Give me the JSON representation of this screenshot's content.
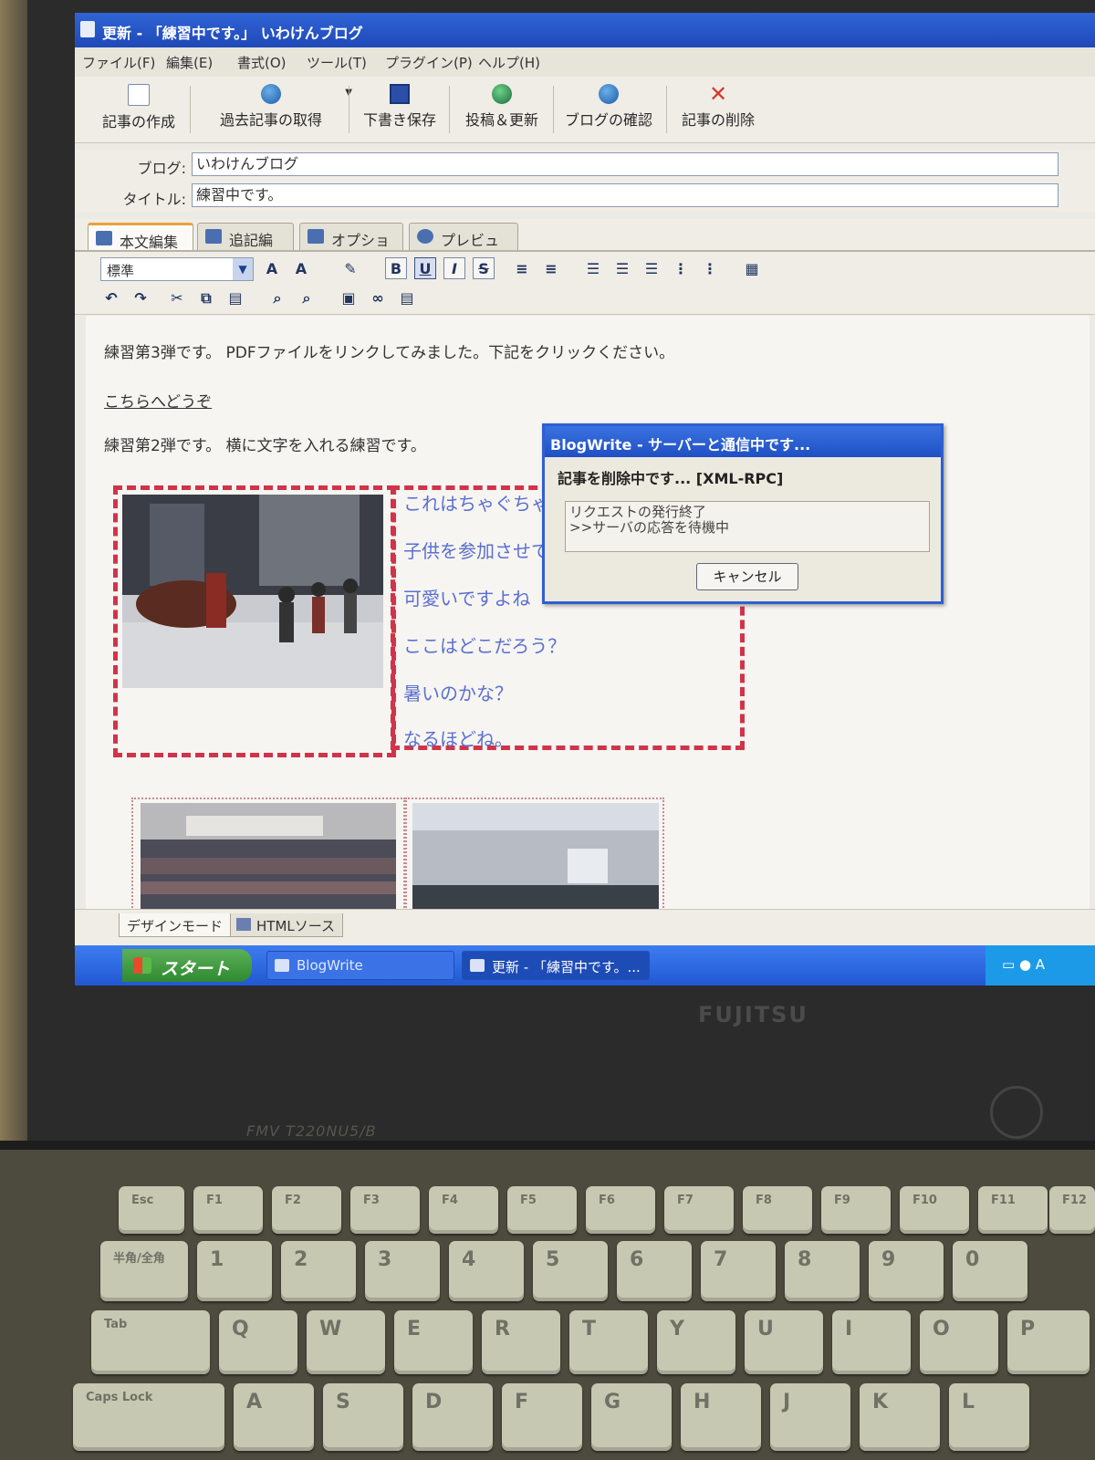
{
  "window": {
    "title": "更新 - 「練習中です。」 いわけんブログ"
  },
  "menubar": {
    "items": [
      "ファイル(F)",
      "編集(E)",
      "書式(O)",
      "ツール(T)",
      "プラグイン(P)",
      "ヘルプ(H)"
    ]
  },
  "toolbar": {
    "create": "記事の作成",
    "fetch": "過去記事の取得",
    "draft": "下書き保存",
    "post": "投稿＆更新",
    "check": "ブログの確認",
    "delete": "記事の削除"
  },
  "fields": {
    "blog_label": "ブログ:",
    "blog_value": "いわけんブログ",
    "title_label": "タイトル:",
    "title_value": "練習中です。"
  },
  "tabs": [
    "本文編集",
    "追記編集",
    "オプション",
    "プレビュー"
  ],
  "format": {
    "style_select": "標準",
    "bold": "B",
    "underline": "U",
    "italic": "I",
    "strike": "S"
  },
  "editor": {
    "line1": "練習第3弾です。 PDFファイルをリンクしてみました。下記をクリックください。",
    "link": "こちらへどうぞ",
    "line2": "練習第2弾です。 横に文字を入れる練習です。",
    "side_text": [
      "これはちゃぐちゃ",
      "子供を参加させて",
      "可愛いですよね",
      "ここはどこだろう？",
      "暑いのかな？",
      "なるほどね。"
    ]
  },
  "view_tabs": {
    "design": "デザインモード",
    "html": "HTMLソース"
  },
  "taskbar": {
    "start": "スタート",
    "task1": "BlogWrite",
    "task2": "更新 - 「練習中です。..."
  },
  "dialog": {
    "title": "BlogWrite - サーバーと通信中です...",
    "message": "記事を削除中です... [XML-RPC]",
    "log_line1": "リクエストの発行終了",
    "log_line2": ">>サーバの応答を待機中",
    "cancel": "キャンセル"
  },
  "laptop": {
    "brand": "FUJITSU",
    "model": "FMV T220NU5/B"
  },
  "keyboard": {
    "fn_row": [
      "Esc",
      "F1",
      "F2",
      "F3",
      "F4",
      "F5",
      "F6",
      "F7",
      "F8",
      "F9",
      "F10",
      "F11",
      "F12"
    ],
    "num_row": [
      "半角/全角",
      "1",
      "2",
      "3",
      "4",
      "5",
      "6",
      "7",
      "8",
      "9",
      "0"
    ],
    "q_row": [
      "Tab",
      "Q",
      "W",
      "E",
      "R",
      "T",
      "Y",
      "U",
      "I",
      "O",
      "P"
    ],
    "a_row": [
      "Caps Lock",
      "A",
      "S",
      "D",
      "F",
      "G",
      "H",
      "J",
      "K",
      "L"
    ]
  },
  "colors": {
    "titlebar": "#2f64d6",
    "dashed_border": "#d0344a",
    "side_text": "#5b6fd0",
    "start_button": "#3f9a3f"
  }
}
